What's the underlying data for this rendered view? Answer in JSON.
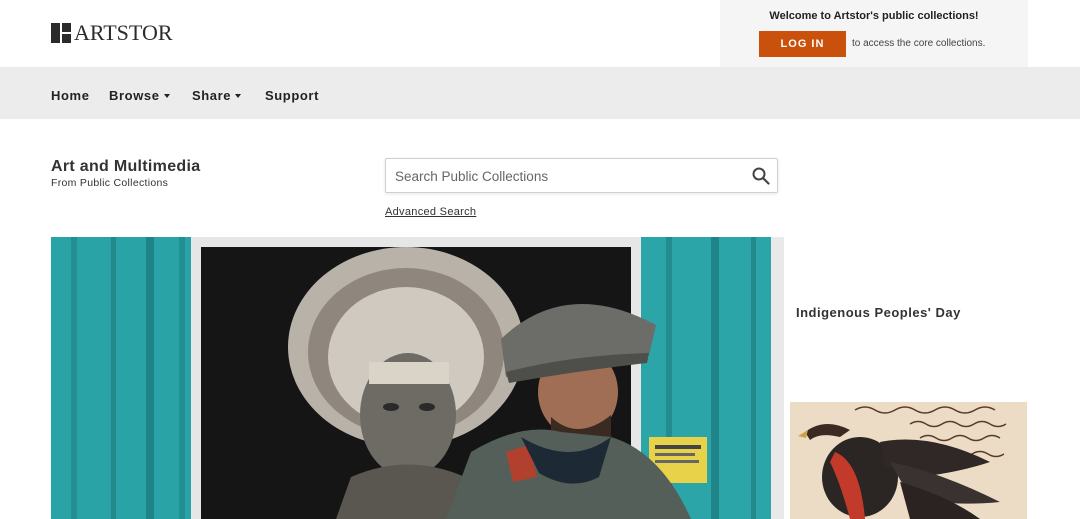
{
  "header": {
    "logo_text": "ARTSTOR",
    "welcome_text": "Welcome to Artstor's public collections!",
    "login_label": "LOG IN",
    "login_note": "to access the core collections."
  },
  "nav": {
    "items": [
      {
        "label": "Home",
        "dropdown": false
      },
      {
        "label": "Browse",
        "dropdown": true
      },
      {
        "label": "Share",
        "dropdown": true
      },
      {
        "label": "Support",
        "dropdown": false
      }
    ]
  },
  "page": {
    "title": "Art and Multimedia",
    "subtitle": "From Public Collections"
  },
  "search": {
    "placeholder": "Search Public Collections",
    "advanced_label": "Advanced Search"
  },
  "feature": {
    "title": "Indigenous Peoples' Day"
  },
  "colors": {
    "accent": "#c9510c",
    "nav_bg": "#ececec",
    "login_bg": "#f5f5f5"
  }
}
